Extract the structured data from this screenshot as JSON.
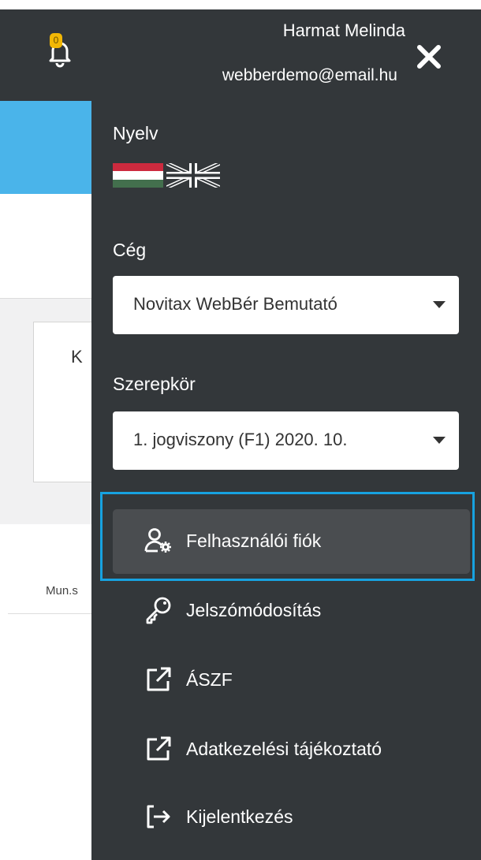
{
  "header": {
    "notification_count": "0",
    "user_name": "Harmat Melinda",
    "user_email": "webberdemo@email.hu",
    "icons": {
      "bell": "bell-icon",
      "close": "close-icon"
    }
  },
  "background_page": {
    "card_text": "K",
    "table_header_fragment": "Mun.s"
  },
  "panel": {
    "language_label": "Nyelv",
    "languages": [
      "Hungarian flag",
      "British flag"
    ],
    "company_label": "Cég",
    "company_selected": "Novitax WebBér Bemutató",
    "role_label": "Szerepkör",
    "role_selected": "1. jogviszony (F1) 2020. 10.",
    "menu": [
      {
        "label": "Felhasználói fiók",
        "icon": "user-gear-icon",
        "active": true
      },
      {
        "label": "Jelszómódosítás",
        "icon": "key-icon",
        "active": false
      },
      {
        "label": "ÁSZF",
        "icon": "external-link-icon",
        "active": false
      },
      {
        "label": "Adatkezelési tájékoztató",
        "icon": "external-link-icon",
        "active": false
      },
      {
        "label": "Kijelentkezés",
        "icon": "logout-icon",
        "active": false
      }
    ]
  },
  "colors": {
    "panel_bg": "#33373a",
    "active_item_bg": "#4a4d50",
    "focus_border": "#17a2e0",
    "accent_blue": "#4ab4ea",
    "badge": "#f2b705"
  }
}
